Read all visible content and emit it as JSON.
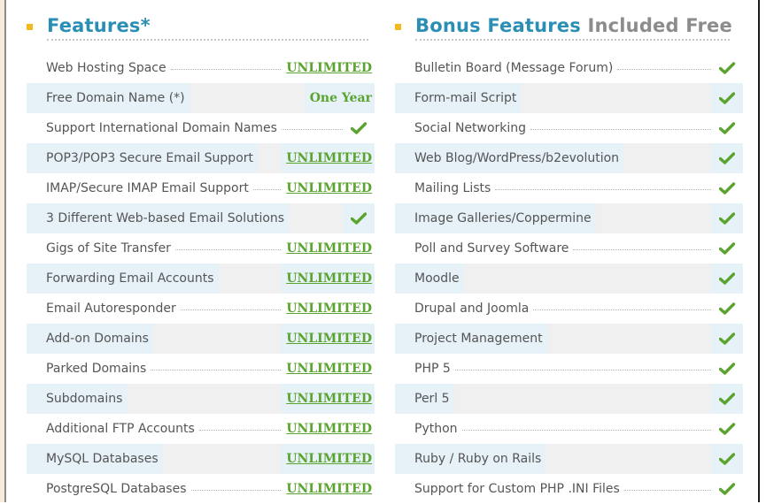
{
  "colors": {
    "accent_blue": "#2b8fb5",
    "muted_gray": "#8c8c8c",
    "value_green": "#5aa32e",
    "bullet_yellow": "#f5b81c",
    "row_alt_bg": "#f0f0f0",
    "row_alt_highlight": "#e6f1f8"
  },
  "features": {
    "title": "Features*",
    "rows": [
      {
        "label": "Web Hosting Space",
        "value": "UNLIMITED",
        "type": "link"
      },
      {
        "label": "Free Domain Name (*)",
        "value": "One Year",
        "type": "text"
      },
      {
        "label": "Support International Domain Names",
        "value": "check-icon",
        "type": "check"
      },
      {
        "label": "POP3/POP3 Secure Email Support",
        "value": "UNLIMITED",
        "type": "link"
      },
      {
        "label": "IMAP/Secure IMAP Email Support",
        "value": "UNLIMITED",
        "type": "link"
      },
      {
        "label": "3 Different Web-based Email Solutions",
        "value": "check-icon",
        "type": "check"
      },
      {
        "label": "Gigs of Site Transfer",
        "value": "UNLIMITED",
        "type": "link"
      },
      {
        "label": "Forwarding Email Accounts",
        "value": "UNLIMITED",
        "type": "link"
      },
      {
        "label": "Email Autoresponder",
        "value": "UNLIMITED",
        "type": "link"
      },
      {
        "label": "Add-on Domains",
        "value": "UNLIMITED",
        "type": "link"
      },
      {
        "label": "Parked Domains",
        "value": "UNLIMITED",
        "type": "link"
      },
      {
        "label": "Subdomains",
        "value": "UNLIMITED",
        "type": "link"
      },
      {
        "label": "Additional FTP Accounts",
        "value": "UNLIMITED",
        "type": "link"
      },
      {
        "label": "MySQL Databases",
        "value": "UNLIMITED",
        "type": "link"
      },
      {
        "label": "PostgreSQL Databases",
        "value": "UNLIMITED",
        "type": "link"
      }
    ]
  },
  "bonus": {
    "title_main": "Bonus Features",
    "title_muted": "Included Free",
    "rows": [
      {
        "label": "Bulletin Board (Message Forum)",
        "value": "check-icon",
        "type": "check"
      },
      {
        "label": "Form-mail Script",
        "value": "check-icon",
        "type": "check"
      },
      {
        "label": "Social Networking",
        "value": "check-icon",
        "type": "check"
      },
      {
        "label": "Web Blog/WordPress/b2evolution",
        "value": "check-icon",
        "type": "check"
      },
      {
        "label": "Mailing Lists",
        "value": "check-icon",
        "type": "check"
      },
      {
        "label": "Image Galleries/Coppermine",
        "value": "check-icon",
        "type": "check"
      },
      {
        "label": "Poll and Survey Software",
        "value": "check-icon",
        "type": "check"
      },
      {
        "label": "Moodle",
        "value": "check-icon",
        "type": "check"
      },
      {
        "label": "Drupal and Joomla",
        "value": "check-icon",
        "type": "check"
      },
      {
        "label": "Project Management",
        "value": "check-icon",
        "type": "check"
      },
      {
        "label": "PHP 5",
        "value": "check-icon",
        "type": "check"
      },
      {
        "label": "Perl 5",
        "value": "check-icon",
        "type": "check"
      },
      {
        "label": "Python",
        "value": "check-icon",
        "type": "check"
      },
      {
        "label": "Ruby / Ruby on Rails",
        "value": "check-icon",
        "type": "check"
      },
      {
        "label": "Support for Custom PHP .INI Files",
        "value": "check-icon",
        "type": "check"
      }
    ]
  }
}
